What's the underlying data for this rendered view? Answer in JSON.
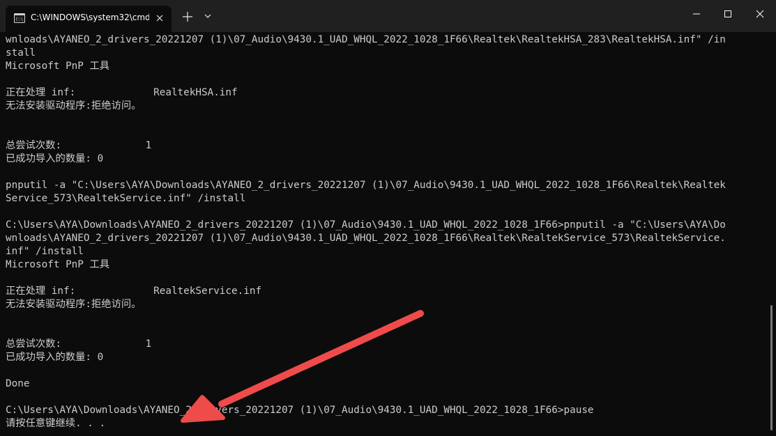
{
  "window": {
    "tab_title": "C:\\WINDOWS\\system32\\cmd.",
    "new_tab_glyph": "+",
    "colors": {
      "titlebar": "#202020",
      "terminal_bg": "#0c0c0c",
      "text": "#cccccc",
      "arrow": "#ef4b4b"
    },
    "icons": [
      "cmd-icon",
      "close-icon",
      "plus-icon",
      "chevron-down-icon",
      "minimize-icon",
      "maximize-icon",
      "close-icon"
    ]
  },
  "terminal": {
    "lines": [
      "wnloads\\AYANEO_2_drivers_20221207 (1)\\07_Audio\\9430.1_UAD_WHQL_2022_1028_1F66\\Realtek\\RealtekHSA_283\\RealtekHSA.inf\" /in",
      "stall",
      "Microsoft PnP 工具",
      "",
      "正在处理 inf:             RealtekHSA.inf",
      "无法安装驱动程序:拒绝访问。",
      "",
      "",
      "总尝试次数:              1",
      "已成功导入的数量: 0",
      "",
      "pnputil -a \"C:\\Users\\AYA\\Downloads\\AYANEO_2_drivers_20221207 (1)\\07_Audio\\9430.1_UAD_WHQL_2022_1028_1F66\\Realtek\\Realtek",
      "Service_573\\RealtekService.inf\" /install",
      "",
      "C:\\Users\\AYA\\Downloads\\AYANEO_2_drivers_20221207 (1)\\07_Audio\\9430.1_UAD_WHQL_2022_1028_1F66>pnputil -a \"C:\\Users\\AYA\\Do",
      "wnloads\\AYANEO_2_drivers_20221207 (1)\\07_Audio\\9430.1_UAD_WHQL_2022_1028_1F66\\Realtek\\RealtekService_573\\RealtekService.",
      "inf\" /install",
      "Microsoft PnP 工具",
      "",
      "正在处理 inf:             RealtekService.inf",
      "无法安装驱动程序:拒绝访问。",
      "",
      "",
      "总尝试次数:              1",
      "已成功导入的数量: 0",
      "",
      "Done",
      "",
      "C:\\Users\\AYA\\Downloads\\AYANEO_2_drivers_20221207 (1)\\07_Audio\\9430.1_UAD_WHQL_2022_1028_1F66>pause",
      "请按任意键继续. . ."
    ]
  }
}
